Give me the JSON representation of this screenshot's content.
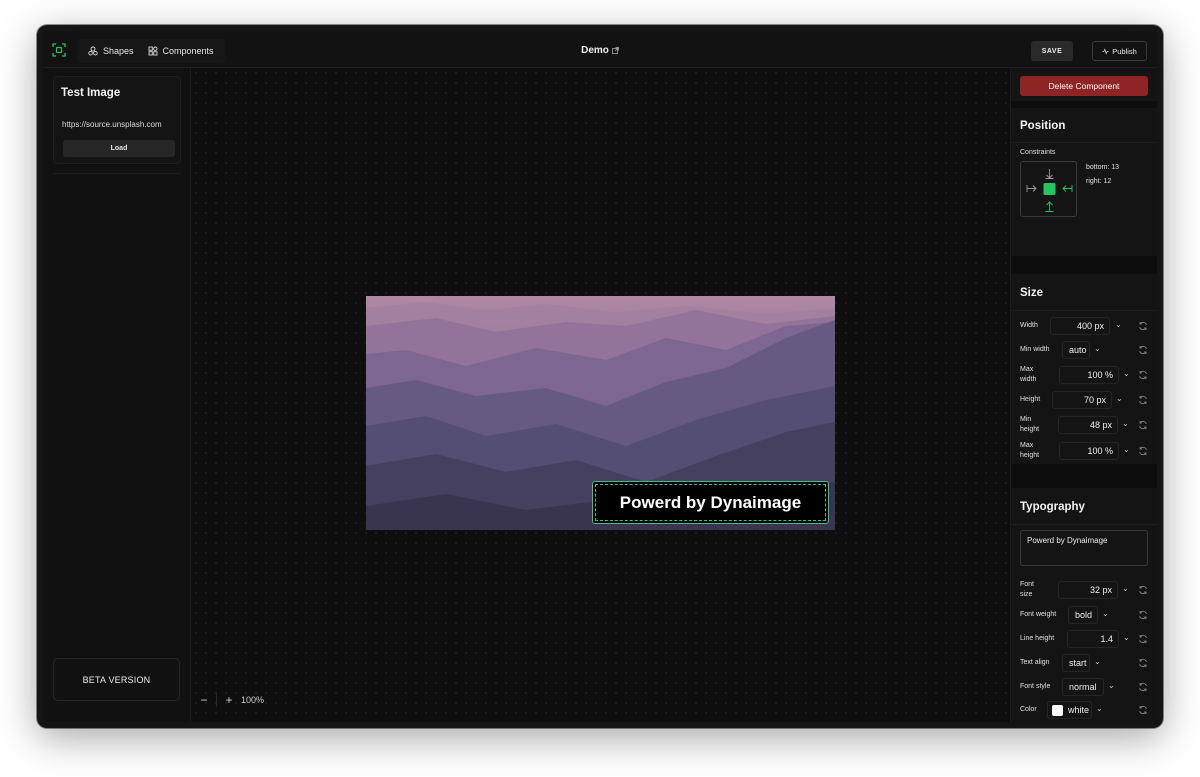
{
  "topbar": {
    "nav": [
      {
        "label": "Shapes",
        "icon": "shapes-icon"
      },
      {
        "label": "Components",
        "icon": "components-icon"
      }
    ],
    "title": "Demo",
    "save_label": "SAVE",
    "publish_label": "Publish"
  },
  "left": {
    "card_title": "Test Image",
    "url_value": "https://source.unsplash.com",
    "load_label": "Load",
    "beta_label": "BETA VERSION"
  },
  "canvas": {
    "overlay_text": "Powerd by Dynaimage",
    "zoom_minus": "−",
    "zoom_plus": "+",
    "zoom_level": "100%"
  },
  "right": {
    "delete_label": "Delete Component",
    "position": {
      "title": "Position",
      "constraints_label": "Constraints",
      "bottom": "bottom: 13",
      "right": "right: 12"
    },
    "size": {
      "title": "Size",
      "width": {
        "label": "Width",
        "value": "400 px"
      },
      "min_width": {
        "label": "Min width",
        "value": "auto"
      },
      "max_width": {
        "label": "Max width",
        "value": "100 %"
      },
      "height": {
        "label": "Height",
        "value": "70 px"
      },
      "min_height": {
        "label": "Min height",
        "value": "48 px"
      },
      "max_height": {
        "label": "Max height",
        "value": "100 %"
      }
    },
    "typography": {
      "title": "Typography",
      "text": "Powerd by Dynaimage",
      "font_size": {
        "label": "Font size",
        "value": "32 px"
      },
      "font_weight": {
        "label": "Font weight",
        "value": "bold"
      },
      "line_height": {
        "label": "Line height",
        "value": "1.4"
      },
      "text_align": {
        "label": "Text align",
        "value": "start"
      },
      "font_style": {
        "label": "Font style",
        "value": "normal"
      },
      "color": {
        "label": "Color",
        "value": "white",
        "swatch": "#ffffff"
      }
    }
  },
  "colors": {
    "accent": "#22c55e",
    "danger": "#8f2424"
  }
}
